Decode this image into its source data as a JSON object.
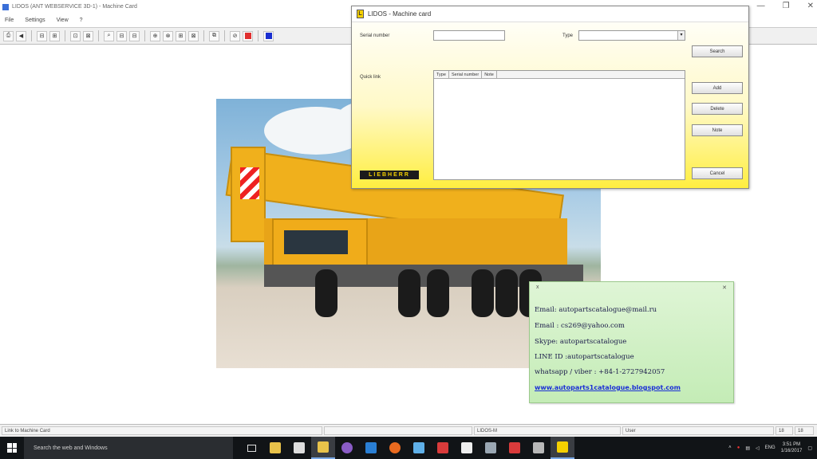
{
  "window": {
    "title": "LIDOS (ANT WEBSERVICE 3D-1) - Machine Card",
    "minimize": "—",
    "restore": "❐",
    "close": "✕"
  },
  "menu": {
    "items": [
      "File",
      "Settings",
      "View",
      "?"
    ]
  },
  "toolbar": {
    "buttons": [
      "⎙",
      "◀",
      "⊟",
      "⊞",
      "⊡",
      "⊠",
      "⌕",
      "⊟",
      "⊟",
      "⊕",
      "⊗",
      "⊞",
      "⊠",
      "⧉",
      "⊘"
    ]
  },
  "dialog": {
    "title": "LIDOS - Machine card",
    "serial_label": "Serial number",
    "serial_value": "",
    "type_label": "Type",
    "type_value": "",
    "search_button": "Search",
    "quick_link_label": "Quick link",
    "columns": [
      "Type",
      "Serial number",
      "Note"
    ],
    "add_button": "Add",
    "delete_button": "Delete",
    "note_button": "Note",
    "cancel_button": "Cancel",
    "brand": "LIEBHERR"
  },
  "contact_note": {
    "close": "✕",
    "pin": "x",
    "lines": [
      "Email: autopartscatalogue@mail.ru",
      "Email : cs269@yahoo.com",
      "Skype: autopartscatalogue",
      "LINE ID :autopartscatalogue",
      "whatsapp / viber : +84-1-2727942057"
    ],
    "link": "www.autoparts1catalogue.blogspot.com"
  },
  "statusbar": {
    "left": "Link to Machine Card",
    "middle": "LIDOS-M",
    "right": "User",
    "page": "18",
    "total": "18"
  },
  "taskbar": {
    "search_placeholder": "Search the web and Windows",
    "tray_lang": "ENG",
    "time": "3:51 PM",
    "date": "1/16/2017"
  },
  "colors": {
    "dialog_gradient_end": "#ffee40",
    "note_bg": "#c4ecb6",
    "link": "#1b2fd6",
    "taskbar": "#111417"
  }
}
